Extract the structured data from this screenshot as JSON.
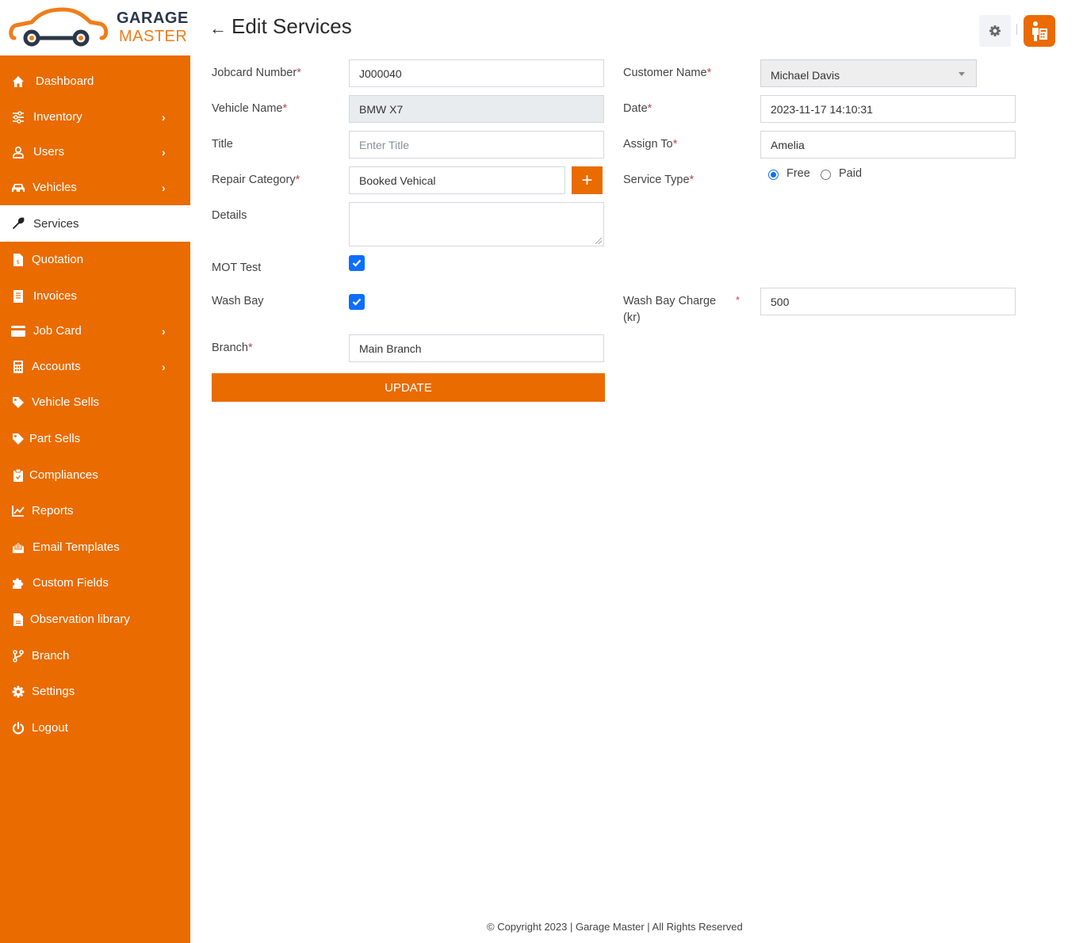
{
  "brand": {
    "line1": "GARAGE",
    "line2": "MASTER",
    "primary_color": "#ea6b00"
  },
  "sidebar": {
    "items": [
      {
        "label": "Dashboard",
        "icon": "home-icon",
        "has_submenu": false,
        "active": false
      },
      {
        "label": "Inventory",
        "icon": "sliders-icon",
        "has_submenu": true,
        "active": false
      },
      {
        "label": "Users",
        "icon": "user-icon",
        "has_submenu": true,
        "active": false
      },
      {
        "label": "Vehicles",
        "icon": "car-icon",
        "has_submenu": true,
        "active": false
      },
      {
        "label": "Services",
        "icon": "wrench-icon",
        "has_submenu": false,
        "active": true
      },
      {
        "label": "Quotation",
        "icon": "file-invoice-dollar-icon",
        "has_submenu": false,
        "active": false
      },
      {
        "label": "Invoices",
        "icon": "receipt-icon",
        "has_submenu": false,
        "active": false
      },
      {
        "label": "Job Card",
        "icon": "credit-card-icon",
        "has_submenu": true,
        "active": false
      },
      {
        "label": "Accounts",
        "icon": "calculator-icon",
        "has_submenu": true,
        "active": false
      },
      {
        "label": "Vehicle Sells",
        "icon": "tag-icon",
        "has_submenu": false,
        "active": false
      },
      {
        "label": "Part Sells",
        "icon": "tag-icon",
        "has_submenu": false,
        "active": false
      },
      {
        "label": "Compliances",
        "icon": "clipboard-check-icon",
        "has_submenu": false,
        "active": false
      },
      {
        "label": "Reports",
        "icon": "chart-line-icon",
        "has_submenu": false,
        "active": false
      },
      {
        "label": "Email Templates",
        "icon": "envelope-open-text-icon",
        "has_submenu": false,
        "active": false
      },
      {
        "label": "Custom Fields",
        "icon": "puzzle-piece-icon",
        "has_submenu": false,
        "active": false
      },
      {
        "label": "Observation library",
        "icon": "file-lines-icon",
        "has_submenu": false,
        "active": false
      },
      {
        "label": "Branch",
        "icon": "code-branch-icon",
        "has_submenu": false,
        "active": false
      },
      {
        "label": "Settings",
        "icon": "gear-icon",
        "has_submenu": false,
        "active": false
      },
      {
        "label": "Logout",
        "icon": "power-icon",
        "has_submenu": false,
        "active": false
      }
    ]
  },
  "header": {
    "title": "Edit Services",
    "back_icon": "arrow-left-icon",
    "settings_icon": "gear-icon",
    "user_icon": "user-report-icon"
  },
  "form": {
    "jobcard_number": {
      "label": "Jobcard Number",
      "required": "*",
      "value": "J000040"
    },
    "vehicle_name": {
      "label": "Vehicle Name",
      "required": "*",
      "value": "BMW X7"
    },
    "title": {
      "label": "Title",
      "value": "",
      "placeholder": "Enter Title"
    },
    "repair_category": {
      "label": "Repair Category",
      "required": "*",
      "value": "Booked Vehical",
      "add_label": "+"
    },
    "details": {
      "label": "Details",
      "value": ""
    },
    "mot_test": {
      "label": "MOT Test",
      "checked": true
    },
    "wash_bay": {
      "label": "Wash Bay",
      "checked": true
    },
    "branch": {
      "label": "Branch",
      "required": "*",
      "value": "Main Branch"
    },
    "customer_name": {
      "label": "Customer Name",
      "required": "*",
      "value": "Michael Davis"
    },
    "date": {
      "label": "Date",
      "required": "*",
      "value": "2023-11-17 14:10:31"
    },
    "assign_to": {
      "label": "Assign To",
      "required": "*",
      "value": "Amelia"
    },
    "service_type": {
      "label": "Service Type",
      "required": "*",
      "options": [
        "Free",
        "Paid"
      ],
      "selected": "Free"
    },
    "wash_bay_charge": {
      "label_line1": "Wash Bay Charge",
      "label_line2": "(kr)",
      "required": "*",
      "value": "500"
    },
    "update_label": "UPDATE"
  },
  "footer": {
    "text": "© Copyright 2023 | Garage Master | All Rights Reserved"
  }
}
